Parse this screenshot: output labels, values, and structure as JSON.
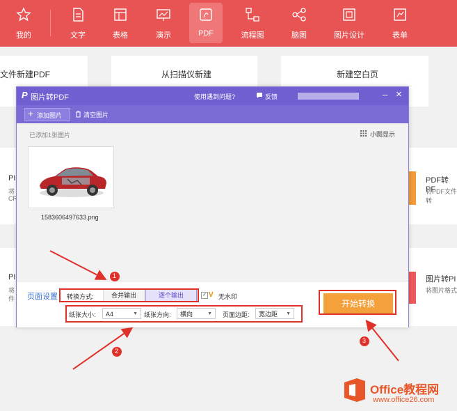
{
  "nav": {
    "items": [
      {
        "label": "我的",
        "icon": "star-icon"
      },
      {
        "label": "文字",
        "icon": "document-icon"
      },
      {
        "label": "表格",
        "icon": "table-icon"
      },
      {
        "label": "演示",
        "icon": "presentation-icon"
      },
      {
        "label": "PDF",
        "icon": "pdf-icon",
        "active": true
      },
      {
        "label": "流程图",
        "icon": "flowchart-icon"
      },
      {
        "label": "脑图",
        "icon": "mindmap-icon"
      },
      {
        "label": "图片设计",
        "icon": "image-design-icon"
      },
      {
        "label": "表单",
        "icon": "form-icon"
      }
    ]
  },
  "background": {
    "cards": [
      "文件新建PDF",
      "从扫描仪新建",
      "新建空白页"
    ],
    "left_letter_1": "PI",
    "left_sub_1a": "将",
    "left_sub_1b": "CR",
    "left_letter_2": "PI",
    "left_sub_2a": "将",
    "left_sub_2b": "件",
    "right_title_1": "PDF转PF",
    "right_sub_1": "将PDF文件转",
    "right_title_2": "图片转PI",
    "right_sub_2": "将图片格式"
  },
  "dialog": {
    "logo": "P",
    "title": "图片转PDF",
    "help": "使用遇到问题?",
    "feedback": "反馈",
    "minimize": "–",
    "close": "×",
    "add_images": "添加图片",
    "clear_images": "清空图片",
    "added_count": "已添加1张图片",
    "view_mode": "小图显示",
    "image_filename": "1583606497633.png",
    "page_settings": "页面设置",
    "convert_mode_label": "转换方式:",
    "merge_output": "合并输出",
    "separate_output": "逐个输出",
    "no_watermark": "无水印",
    "paper_size_label": "纸张大小:",
    "paper_size_value": "A4",
    "orientation_label": "纸张方向:",
    "orientation_value": "横向",
    "margin_label": "页面边距:",
    "margin_value": "宽边距",
    "start_button": "开始转换"
  },
  "annotations": {
    "one": "1",
    "two": "2",
    "three": "3"
  },
  "watermark": {
    "brand": "Office教程网",
    "url": "www.office26.com"
  },
  "colors": {
    "nav_red": "#e85454",
    "dialog_purple": "#6f5fd0",
    "start_orange": "#f4a13c",
    "annotation_red": "#e0302a"
  }
}
